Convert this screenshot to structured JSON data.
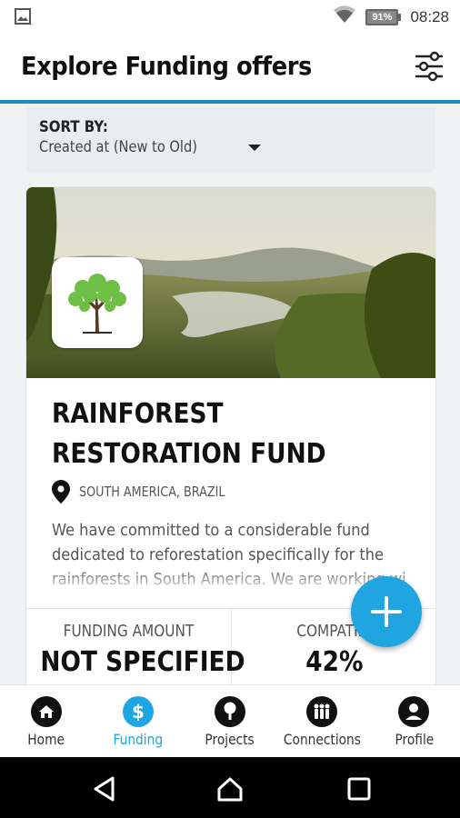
{
  "status_bar": {
    "battery": "91%",
    "time": "08:28",
    "icons": [
      "image-notification-icon",
      "wifi-icon",
      "battery-icon"
    ]
  },
  "header": {
    "title": "Explore Funding offers",
    "filter_icon": "sliders-icon"
  },
  "sort": {
    "label": "SORT BY:",
    "value": "Created at (New to Old)"
  },
  "card": {
    "title": "RAINFOREST RESTORATION FUND",
    "location": "SOUTH AMERICA, BRAZIL",
    "description": "We have committed to a considerable fund dedicated to reforestation specifically for the rainforests in South America. We are working wi",
    "stats": [
      {
        "label": "FUNDING AMOUNT",
        "value": "NOT SPECIFIED"
      },
      {
        "label": "COMPATIBI",
        "value": "42%"
      }
    ]
  },
  "fab": {
    "icon": "plus-icon"
  },
  "bottom_nav": {
    "items": [
      {
        "label": "Home",
        "icon": "home-icon",
        "active": false
      },
      {
        "label": "Funding",
        "icon": "dollar-icon",
        "active": true
      },
      {
        "label": "Projects",
        "icon": "tree-icon",
        "active": false
      },
      {
        "label": "Connections",
        "icon": "people-icon",
        "active": false
      },
      {
        "label": "Profile",
        "icon": "user-icon",
        "active": false
      }
    ]
  },
  "colors": {
    "accent": "#1fa5e0",
    "header_border": "#1f88c6",
    "background": "#f1f2f4"
  }
}
